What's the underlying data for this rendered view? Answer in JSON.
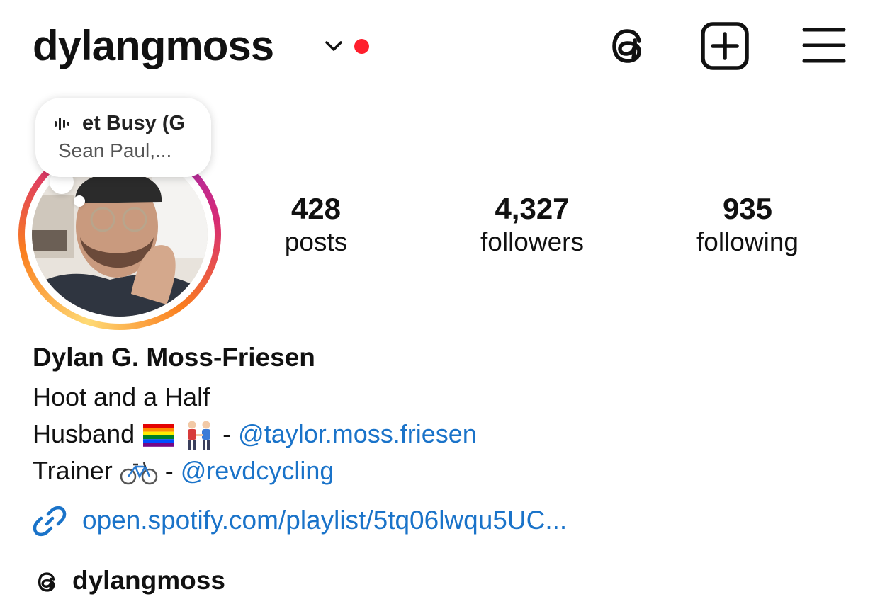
{
  "header": {
    "username": "dylangmoss",
    "icons": [
      "chevron-down-icon",
      "notification-dot",
      "threads-icon",
      "new-post-icon",
      "menu-icon"
    ]
  },
  "note": {
    "song": "et Busy (G",
    "artist": "Sean Paul,..."
  },
  "stats": {
    "posts": {
      "value": "428",
      "label": "posts"
    },
    "followers": {
      "value": "4,327",
      "label": "followers"
    },
    "following": {
      "value": "935",
      "label": "following"
    }
  },
  "profile": {
    "full_name": "Dylan G. Moss-Friesen",
    "bio_line1": "Hoot and a Half",
    "bio_line2_prefix": "Husband",
    "bio_line2_sep": "-",
    "bio_line2_mention": "@taylor.moss.friesen",
    "bio_line3_prefix": "Trainer",
    "bio_line3_sep": "-",
    "bio_line3_mention": "@revdcycling",
    "link": "open.spotify.com/playlist/5tq06lwqu5UC...",
    "threads_handle": "dylangmoss"
  },
  "colors": {
    "link_blue": "#1a73c9",
    "notification_red": "#ff1f2d"
  }
}
